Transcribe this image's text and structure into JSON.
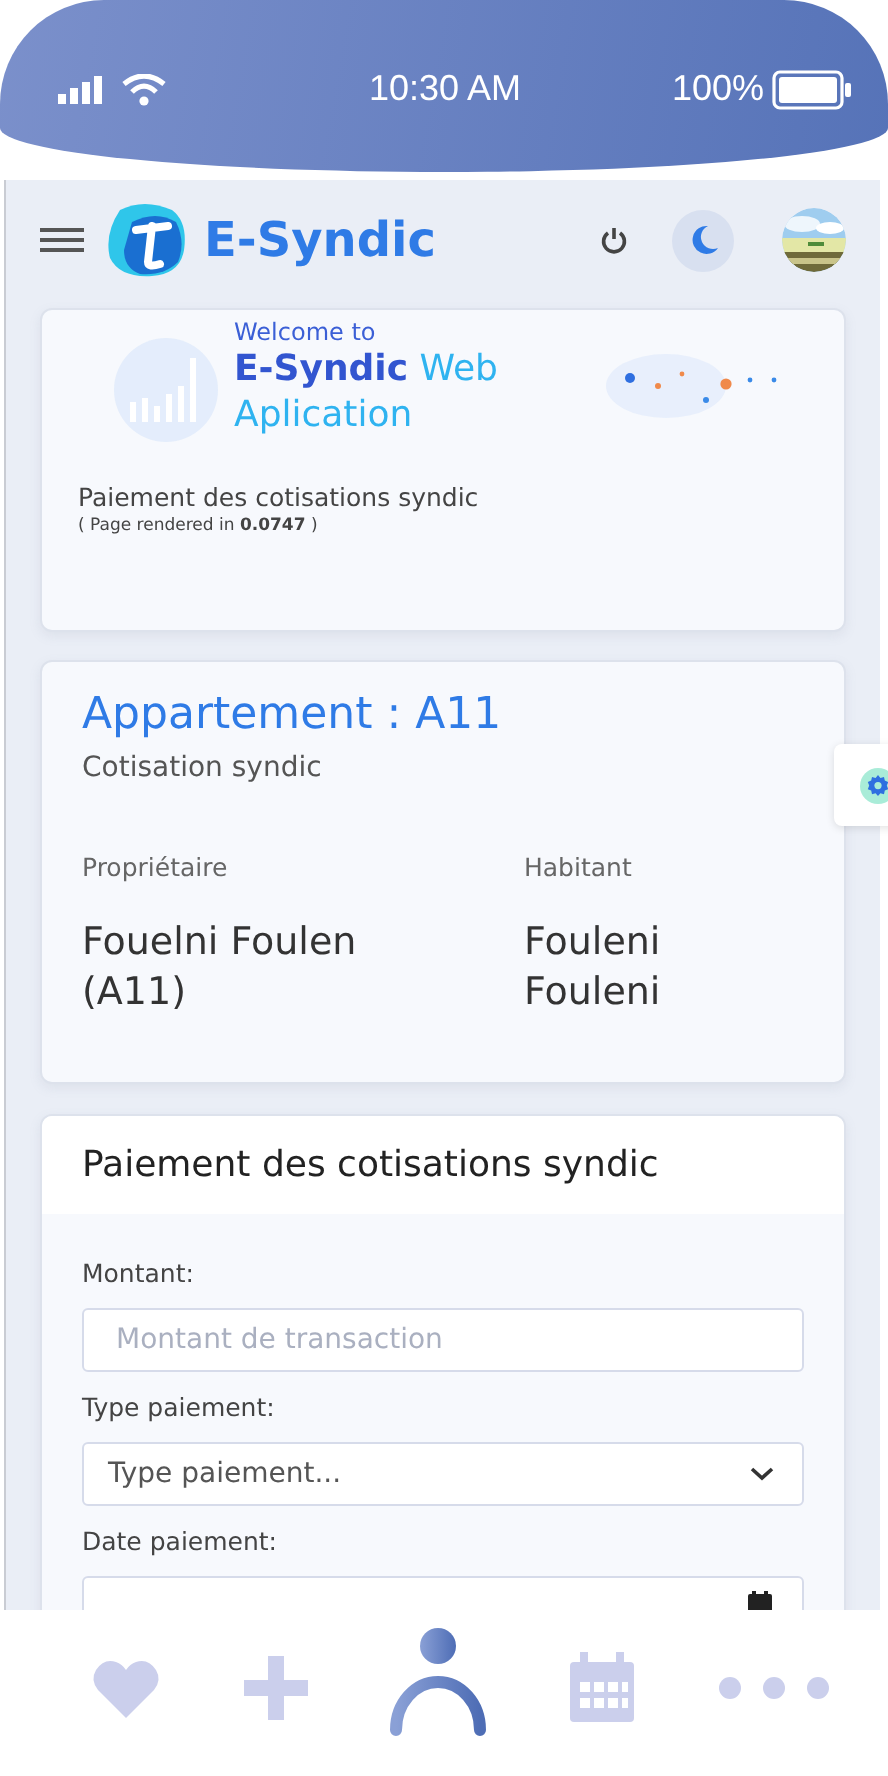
{
  "status_bar": {
    "time": "10:30 AM",
    "battery": "100%"
  },
  "topbar": {
    "brand": "E-Syndic"
  },
  "welcome": {
    "greeting": "Welcome to",
    "title": "**E-Syndic** Web Aplication",
    "subtitle": "Paiement des cotisations syndic",
    "render_note": "( Page rendered in **0.0747** )"
  },
  "apartment": {
    "title": "Appartement : A11",
    "subtitle": "Cotisation syndic",
    "columns": [
      {
        "label": "Propriétaire",
        "value": "Fouelni Foulen (A11)"
      },
      {
        "label": "Habitant",
        "value": "Fouleni Fouleni"
      }
    ]
  },
  "payment_form": {
    "title": "Paiement des cotisations syndic",
    "fields": [
      {
        "kind": "text",
        "label": "Montant:",
        "placeholder": "Montant de transaction"
      },
      {
        "kind": "select",
        "label": "Type paiement:",
        "value": "Type paiement..."
      },
      {
        "kind": "date",
        "label": "Date paiement:"
      }
    ]
  },
  "bottom_nav": [
    {
      "kind": "heart",
      "selected": false
    },
    {
      "kind": "plus",
      "selected": false
    },
    {
      "kind": "person",
      "selected": true
    },
    {
      "kind": "calendar",
      "selected": false
    },
    {
      "kind": "more",
      "selected": false
    }
  ]
}
